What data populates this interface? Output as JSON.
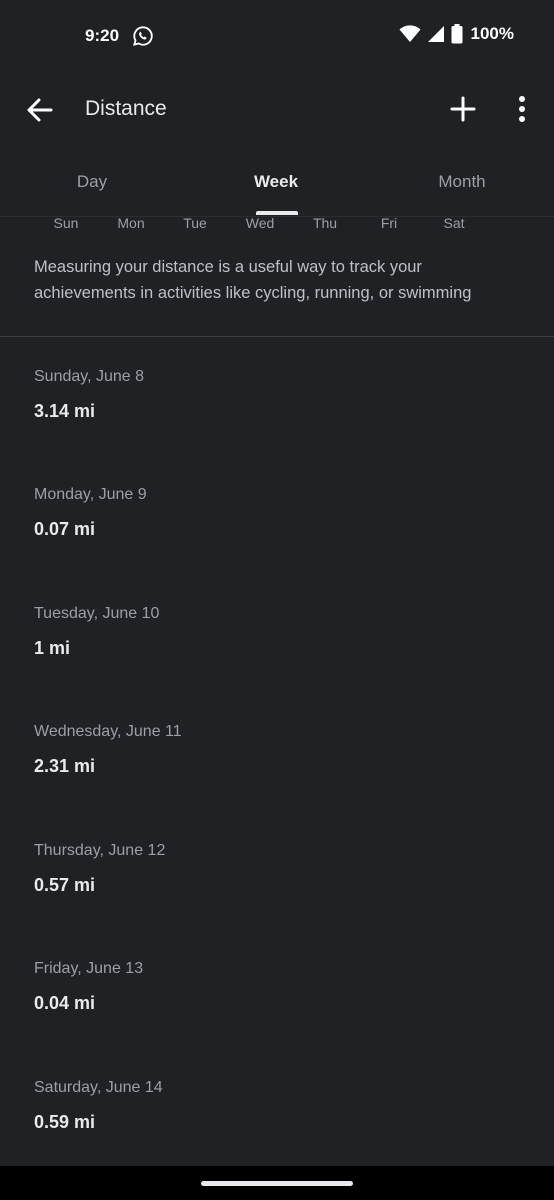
{
  "status_bar": {
    "time": "9:20",
    "notification_icon": "whatsapp-icon",
    "battery": "100%"
  },
  "app_bar": {
    "title": "Distance",
    "back_icon": "arrow-back-icon",
    "add_icon": "plus-icon",
    "more_icon": "more-vert-icon"
  },
  "tabs": [
    {
      "label": "Day",
      "active": false
    },
    {
      "label": "Week",
      "active": true
    },
    {
      "label": "Month",
      "active": false
    }
  ],
  "days": [
    "Sun",
    "Mon",
    "Tue",
    "Wed",
    "Thu",
    "Fri",
    "Sat"
  ],
  "description": "Measuring your distance is a useful way to track your achievements in activities like cycling, running, or swimming",
  "entries": [
    {
      "date": "Sunday, June 8",
      "value": "3.14 mi"
    },
    {
      "date": "Monday, June 9",
      "value": "0.07 mi"
    },
    {
      "date": "Tuesday, June 10",
      "value": "1 mi"
    },
    {
      "date": "Wednesday, June 11",
      "value": "2.31 mi"
    },
    {
      "date": "Thursday, June 12",
      "value": "0.57 mi"
    },
    {
      "date": "Friday, June 13",
      "value": "0.04 mi"
    },
    {
      "date": "Saturday, June 14",
      "value": "0.59 mi"
    }
  ],
  "colors": {
    "background": "#202124",
    "text_primary": "#e8eaed",
    "text_secondary": "#9aa0a6"
  }
}
